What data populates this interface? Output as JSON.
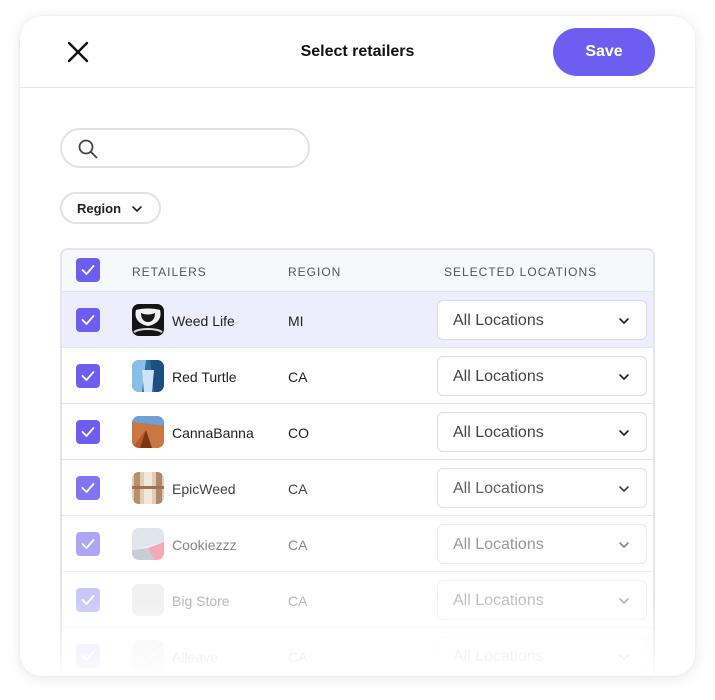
{
  "header": {
    "title": "Select retailers",
    "save_label": "Save"
  },
  "search": {
    "value": "",
    "placeholder": ""
  },
  "filters": {
    "region_label": "Region"
  },
  "table": {
    "columns": [
      "RETAILERS",
      "REGION",
      "SELECTED LOCATIONS"
    ],
    "select_all_checked": true,
    "rows": [
      {
        "name": "Weed Life",
        "region": "MI",
        "locations": "All Locations",
        "checked": true
      },
      {
        "name": "Red Turtle",
        "region": "CA",
        "locations": "All Locations",
        "checked": true
      },
      {
        "name": "CannaBanna",
        "region": "CO",
        "locations": "All Locations",
        "checked": true
      },
      {
        "name": "EpicWeed",
        "region": "CA",
        "locations": "All Locations",
        "checked": true
      },
      {
        "name": "Cookiezzz",
        "region": "CA",
        "locations": "All Locations",
        "checked": true
      },
      {
        "name": "Big Store",
        "region": "CA",
        "locations": "All Locations",
        "checked": true
      },
      {
        "name": "Alleave",
        "region": "CA",
        "locations": "All Locations",
        "checked": true
      }
    ]
  },
  "colors": {
    "accent": "#6b5ef0",
    "row_highlight": "#eeedfd",
    "header_bg": "#f7f8fb"
  },
  "icons": {
    "close": "close-icon",
    "search": "search-icon",
    "chevron": "chevron-down-icon",
    "check": "check-icon"
  }
}
